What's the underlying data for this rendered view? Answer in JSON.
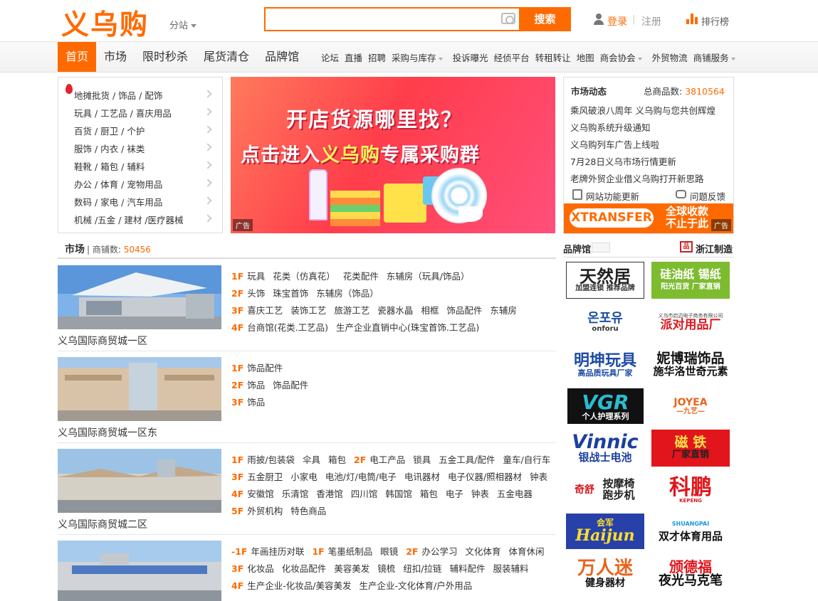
{
  "header": {
    "logo": "义乌购",
    "branch": "分站",
    "search_placeholder": "",
    "search_button": "搜索",
    "login": "登录",
    "separator": "|",
    "register": "注册",
    "rank": "排行榜"
  },
  "nav": {
    "main": [
      "首页",
      "市场",
      "限时秒杀",
      "尾货清仓",
      "品牌馆"
    ],
    "sub": [
      "论坛",
      "直播",
      "招聘",
      "采购与库存",
      "投诉曝光",
      "经侦平台",
      "转租转让",
      "地图",
      "商会协会",
      "外贸物流",
      "商铺服务"
    ]
  },
  "categories": [
    "地摊批货 / 饰品 / 配饰",
    "玩具 / 工艺品 / 喜庆用品",
    "百货 / 厨卫 / 个护",
    "服饰 / 内衣 / 袜类",
    "鞋靴 / 箱包 / 辅料",
    "办公 / 体育 / 宠物用品",
    "数码 / 家电 / 汽车用品",
    "机械 /五金 / 建材 /医疗器械"
  ],
  "banner": {
    "line1": "开店货源哪里找？",
    "line2_a": "点击进入",
    "line2_b": "义乌购",
    "line2_c": "专属采购群",
    "ad": "广告"
  },
  "news": {
    "title": "市场动态",
    "total_label": "总商品数:",
    "total_value": "3810564",
    "items": [
      "乘风破浪八周年 义乌购与您共创辉煌",
      "义乌购系统升级通知",
      "义乌购列车广告上线啦",
      "7月28日义乌市场行情更新",
      "老牌外贸企业借义乌购打开新思路"
    ],
    "update": "网站功能更新",
    "feedback": "问题反馈",
    "ad_logo": "XTRANSFER",
    "ad_text1": "全球收款",
    "ad_text2": "不止于此",
    "ad": "广告"
  },
  "market": {
    "title": "市场",
    "count_label": "商铺数:",
    "count_value": "50456",
    "malls": [
      {
        "name": "义乌国际商贸城一区",
        "rows": [
          [
            [
              "1F",
              [
                "玩具",
                "花类（仿真花）",
                "花类配件",
                "东辅房（玩具/饰品）"
              ]
            ]
          ],
          [
            [
              "2F",
              [
                "头饰",
                "珠宝首饰",
                "东辅房（饰品）"
              ]
            ]
          ],
          [
            [
              "3F",
              [
                "喜庆工艺",
                "装饰工艺",
                "旅游工艺",
                "瓷器水晶",
                "相框",
                "饰品配件",
                "东辅房"
              ]
            ]
          ],
          [
            [
              "4F",
              [
                "台商馆(花类.工艺品)",
                "生产企业直销中心(珠宝首饰.工艺品)"
              ]
            ]
          ]
        ]
      },
      {
        "name": "义乌国际商贸城一区东",
        "rows": [
          [
            [
              "1F",
              [
                "饰品配件"
              ]
            ]
          ],
          [
            [
              "2F",
              [
                "饰品",
                "饰品配件"
              ]
            ]
          ],
          [
            [
              "3F",
              [
                "饰品"
              ]
            ]
          ]
        ]
      },
      {
        "name": "义乌国际商贸城二区",
        "rows": [
          [
            [
              "1F",
              [
                "雨披/包装袋",
                "伞具",
                "箱包"
              ]
            ],
            [
              "2F",
              [
                "电工产品",
                "锁具",
                "五金工具/配件",
                "童车/自行车"
              ]
            ]
          ],
          [
            [
              "3F",
              [
                "五金厨卫",
                "小家电",
                "电池/灯/电筒/电子",
                "电讯器材",
                "电子仪器/照相器材",
                "钟表"
              ]
            ]
          ],
          [
            [
              "4F",
              [
                "安徽馆",
                "乐清馆",
                "香港馆",
                "四川馆",
                "韩国馆",
                "箱包",
                "电子",
                "钟表",
                "五金电器"
              ]
            ]
          ],
          [
            [
              "5F",
              [
                "外贸机构",
                "特色商品"
              ]
            ]
          ]
        ]
      },
      {
        "name": "",
        "rows": [
          [
            [
              "-1F",
              [
                "年画挂历对联"
              ]
            ],
            [
              "1F",
              [
                "笔墨纸制品",
                "眼镜"
              ]
            ],
            [
              "2F",
              [
                "办公学习",
                "文化体育",
                "体育休闲"
              ]
            ]
          ],
          [
            [
              "3F",
              [
                "化妆品",
                "化妆品配件",
                "美容美发",
                "镜梳",
                "纽扣/拉链",
                "辅料配件",
                "服装辅料"
              ]
            ]
          ],
          [
            [
              "4F",
              [
                "生产企业-化妆品/美容美发",
                "生产企业-文化体育/户外用品"
              ]
            ]
          ]
        ]
      }
    ]
  },
  "brands": {
    "title": "品牌馆",
    "zj_icon": "品",
    "zj": "浙江制造",
    "list": [
      {
        "t": "天然居",
        "s": "加盟连锁 推荐品牌"
      },
      {
        "t": "硅油纸 锡纸",
        "s": "阳光百货 厂家直销"
      },
      {
        "t": "온포유",
        "s": "onforu"
      },
      {
        "t": "派对用品厂",
        "s": "义乌市启迈电子商务有限公司"
      },
      {
        "t": "明坤玩具",
        "s": "高品质玩具厂家"
      },
      {
        "t": "妮博瑞饰品",
        "s": "施华洛世奇元素"
      },
      {
        "t": "VGR",
        "s": "个人护理系列"
      },
      {
        "t": "JOYEA",
        "s": "—九艺—"
      },
      {
        "t": "Vinnic",
        "s": "银战士电池"
      },
      {
        "t": "磁 铁",
        "s": "厂家直销"
      },
      {
        "t": "奇舒",
        "s": "按摩椅 跑步机"
      },
      {
        "t": "科鹏",
        "s": "KEPENG"
      },
      {
        "t": "Haijun",
        "s": "会军"
      },
      {
        "t": "双才体育用品",
        "s": "SHUANGPAI"
      },
      {
        "t": "万人迷",
        "s": "健身器材"
      },
      {
        "t": "颁德福",
        "s": "夜光马克笔"
      }
    ]
  },
  "colors": {
    "accent": "#ff6a00"
  }
}
